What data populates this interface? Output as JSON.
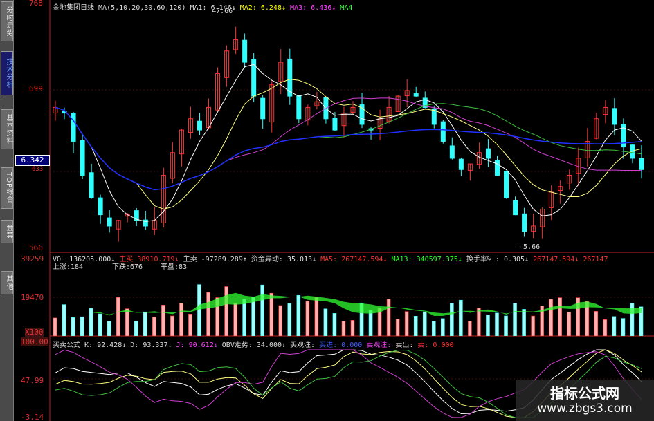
{
  "side_tabs": [
    {
      "label": "分时走势",
      "active": false
    },
    {
      "label": "技术分析",
      "active": true
    },
    {
      "label": "基本资料",
      "active": false
    },
    {
      "label": "TOP综合",
      "active": false
    },
    {
      "label": "金算",
      "active": false
    },
    {
      "label": "其他",
      "active": false
    }
  ],
  "price_panel": {
    "title": "金地集团日线",
    "ma_params": "MA(5,10,20,30,60,120)",
    "ma1": "MA1: 6.146↓",
    "ma2": "MA2: 6.248↓",
    "ma3": "MA3: 6.436↓",
    "ma4": "MA4",
    "high_marker": "7.66",
    "low_marker": "5.66",
    "axis": {
      "top": "768",
      "mid": "699",
      "current": "6.342",
      "low1": "633",
      "bottom": "566"
    }
  },
  "volume_panel": {
    "vol": "VOL 136205.000↓",
    "zhumai": "主买 38910.719↓",
    "zhumai2": "主卖 -97289.289↑",
    "zijin": "资金异动: 35.013↓",
    "ma5": "MA5: 267147.594↓",
    "ma13": "MA13: 340597.375↓",
    "huanshou": "换手率% : 0.305↓",
    "extra": "267147.594↓  267147",
    "shangzhang": "上涨:184",
    "xiadie": "下跌:676",
    "pingpan": "平盘:83",
    "axis": {
      "top": "39259",
      "mid": "19470",
      "unit": "X100"
    }
  },
  "indicator_panel": {
    "name": "买卖公式",
    "k": "K: 92.428↓",
    "d": "D: 93.337↓",
    "j": "J: 90.612↓",
    "obv": "OBV走势: 34.000↓",
    "mai": "买观注: ",
    "buy": "买进: 0.000",
    "sell": "卖观注: ",
    "out": "卖出: ",
    "tail": "卖: 0.000",
    "axis": {
      "top": "100.00",
      "mid": "47.99",
      "bottom": "-3.14"
    }
  },
  "watermark": {
    "title": "指标公式网",
    "url": "www.zbgs3.com"
  },
  "colors": {
    "up": "#ff3030",
    "down": "#30ffff",
    "ma_white": "#ffffff",
    "ma_yellow": "#ffff80",
    "ma_magenta": "#d040d0",
    "ma_green": "#40c040",
    "ma_blue": "#2030ff",
    "vol_green": "#30ff30"
  },
  "chart_data": {
    "type": "line",
    "title": "金地集团日线",
    "ylim": [
      5.66,
      7.68
    ],
    "close": [
      6.9,
      6.85,
      6.6,
      6.3,
      6.1,
      5.95,
      5.85,
      5.9,
      5.95,
      5.9,
      5.85,
      5.9,
      6.3,
      6.5,
      6.7,
      6.8,
      6.7,
      6.9,
      7.2,
      7.4,
      7.5,
      7.3,
      7.0,
      6.8,
      7.1,
      7.3,
      7.0,
      6.8,
      6.9,
      6.95,
      6.8,
      6.7,
      6.85,
      6.9,
      6.75,
      6.7,
      6.8,
      6.9,
      7.0,
      7.05,
      7.0,
      6.9,
      6.75,
      6.6,
      6.45,
      6.35,
      6.4,
      6.5,
      6.45,
      6.3,
      6.1,
      5.95,
      5.8,
      5.85,
      6.0,
      6.15,
      6.2,
      6.3,
      6.45,
      6.6,
      6.8,
      6.9,
      6.75,
      6.55,
      6.45,
      6.35
    ]
  }
}
